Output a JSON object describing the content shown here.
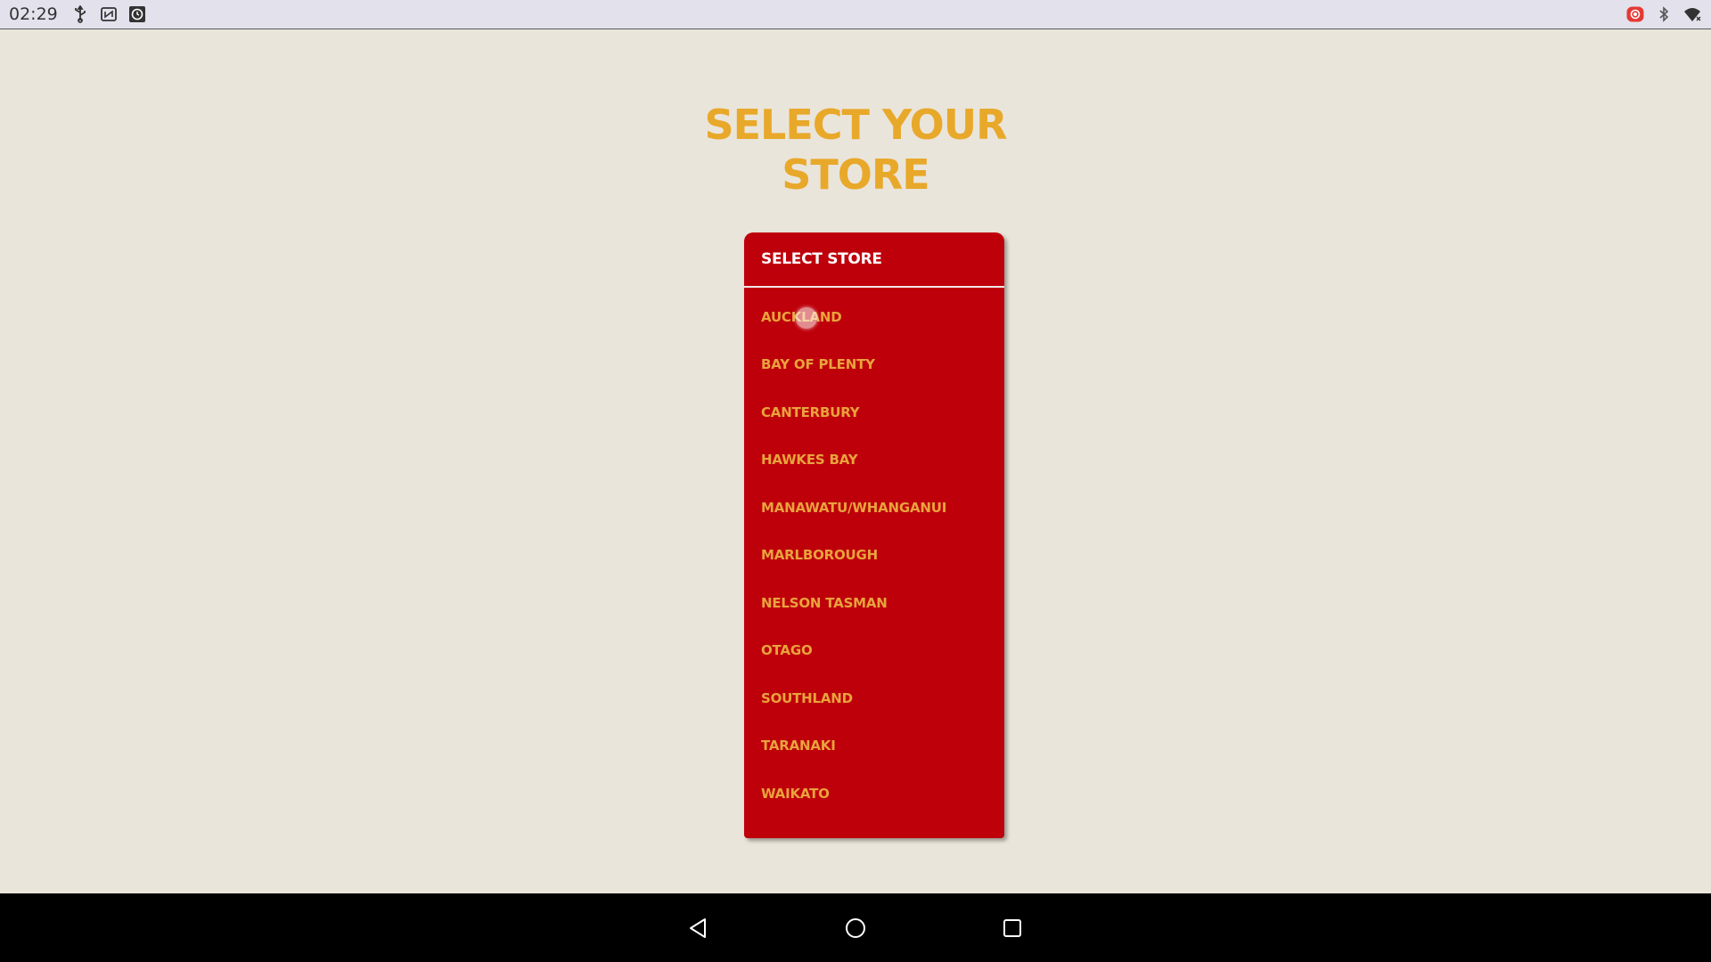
{
  "status_bar": {
    "time": "02:29",
    "left_icons": [
      "usb-icon",
      "nfc-off-icon",
      "clock-app-icon"
    ],
    "right_icons": [
      "screen-record-icon",
      "bluetooth-icon",
      "wifi-icon"
    ]
  },
  "page": {
    "title_line1": "SELECT YOUR",
    "title_line2": "STORE"
  },
  "dropdown": {
    "header": "SELECT STORE",
    "items": [
      {
        "label": "AUCKLAND"
      },
      {
        "label": "BAY OF PLENTY"
      },
      {
        "label": "CANTERBURY"
      },
      {
        "label": "HAWKES BAY"
      },
      {
        "label": "MANAWATU/WHANGANUI"
      },
      {
        "label": "MARLBOROUGH"
      },
      {
        "label": "NELSON TASMAN"
      },
      {
        "label": "OTAGO"
      },
      {
        "label": "SOUTHLAND"
      },
      {
        "label": "TARANAKI"
      },
      {
        "label": "WAIKATO"
      }
    ]
  },
  "colors": {
    "background": "#EAE5DA",
    "title": "#E8A82A",
    "dropdown_bg": "#BE000B",
    "item_text": "#E9A33C",
    "header_text": "#FFFFFF"
  },
  "nav_bar": {
    "buttons": [
      "back-icon",
      "home-icon",
      "recents-icon"
    ]
  }
}
